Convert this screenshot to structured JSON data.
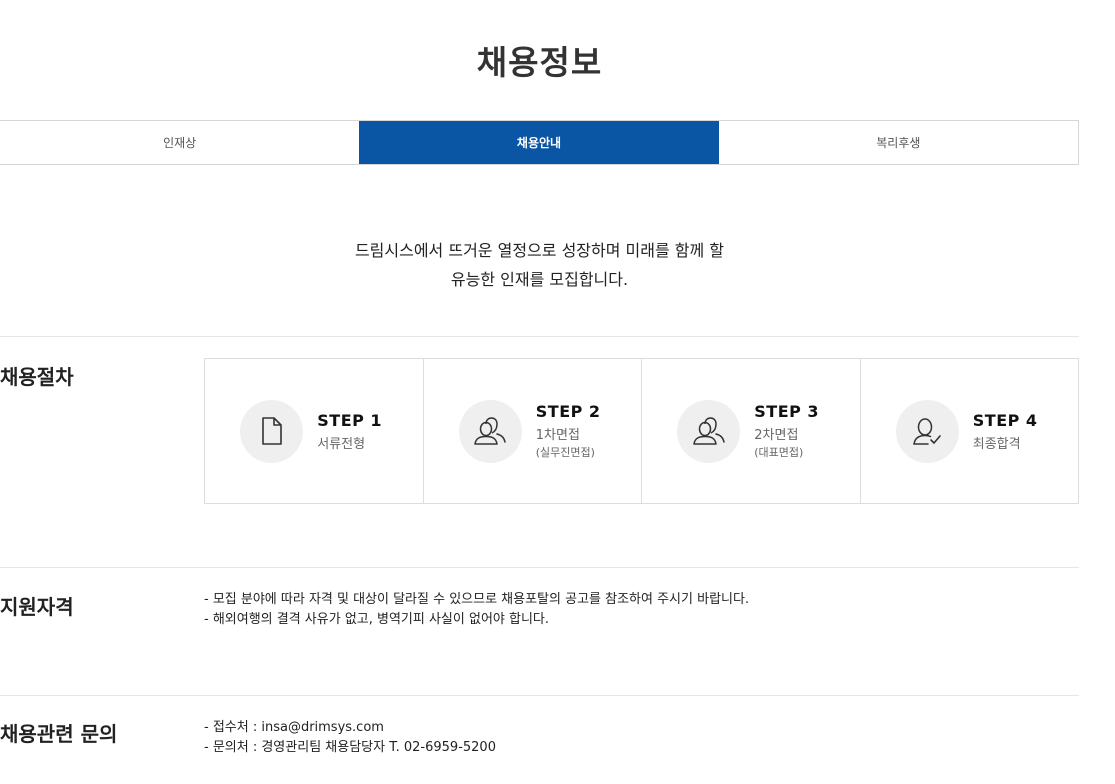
{
  "page": {
    "title": "채용정보"
  },
  "tabs": [
    {
      "label": "인재상",
      "active": false
    },
    {
      "label": "채용안내",
      "active": true
    },
    {
      "label": "복리후생",
      "active": false
    }
  ],
  "intro": {
    "line1": "드림시스에서 뜨거운 열정으로 성장하며 미래를 함께 할",
    "line2": "유능한 인재를 모집합니다."
  },
  "process": {
    "title": "채용절차",
    "steps": [
      {
        "label": "STEP 1",
        "name": "서류전형",
        "sub": "",
        "icon": "document-icon"
      },
      {
        "label": "STEP 2",
        "name": "1차면접",
        "sub": "(실무진면접)",
        "icon": "users-icon"
      },
      {
        "label": "STEP 3",
        "name": "2차면접",
        "sub": "(대표면접)",
        "icon": "users-icon"
      },
      {
        "label": "STEP 4",
        "name": "최종합격",
        "sub": "",
        "icon": "user-check-icon"
      }
    ]
  },
  "qualification": {
    "title": "지원자격",
    "lines": [
      "- 모집 분야에 따라 자격 및 대상이 달라질 수 있으므로 채용포탈의 공고를 참조하여 주시기 바랍니다.",
      "- 해외여행의 결격 사유가 없고, 병역기피 사실이 없어야 합니다."
    ]
  },
  "contact": {
    "title": "채용관련 문의",
    "lines": [
      "- 접수처 : insa@drimsys.com",
      "- 문의처 : 경영관리팀 채용담당자 T. 02-6959-5200"
    ]
  },
  "colors": {
    "accent": "#0b55a5",
    "icon_bg": "#efefef",
    "border": "#dddddd"
  }
}
